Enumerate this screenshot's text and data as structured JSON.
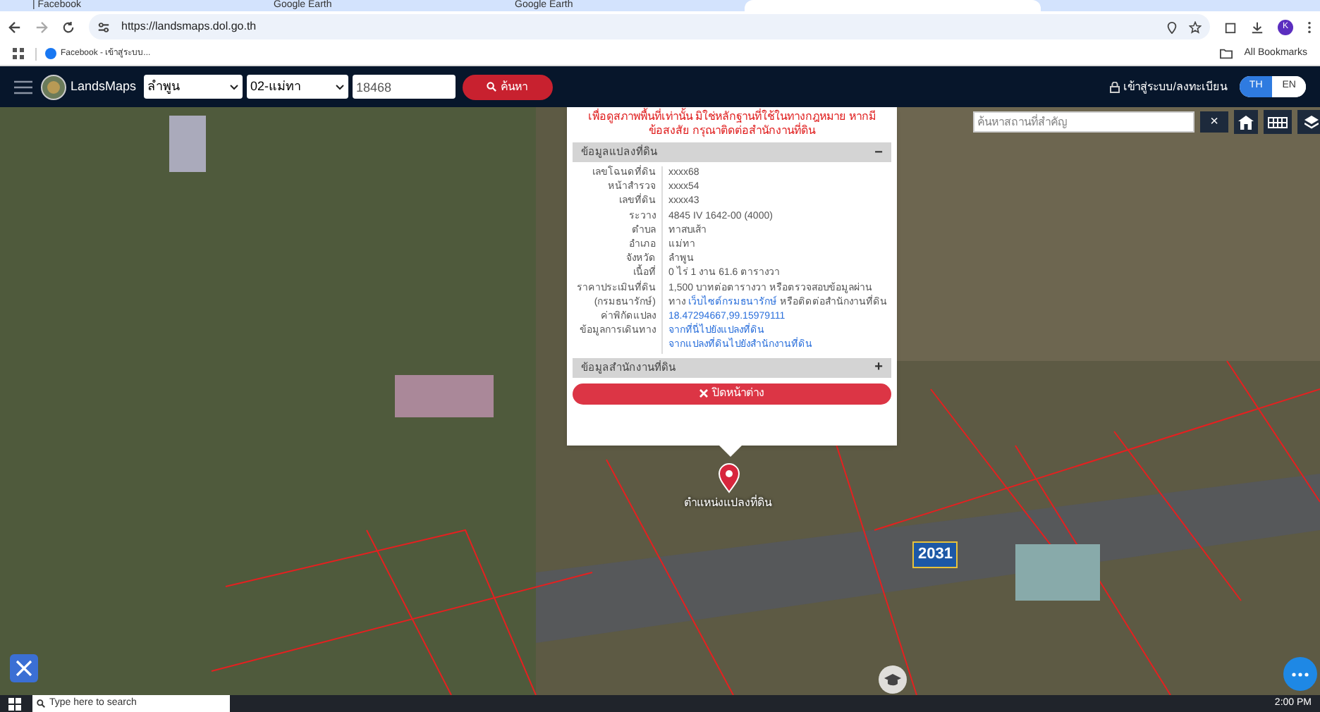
{
  "browser": {
    "tabs": [
      {
        "title": "| Facebook",
        "selected": false
      },
      {
        "title": "Google Earth",
        "selected": false
      },
      {
        "title": "Google Earth",
        "selected": false
      },
      {
        "selected": true
      }
    ],
    "url": "https://landsmaps.dol.go.th",
    "bookmarks": [
      {
        "label": "Facebook - เข้าสู่ระบบ..."
      }
    ],
    "all_bookmarks": "All Bookmarks",
    "profile": "K"
  },
  "app": {
    "brand": "LandsMaps",
    "province": "ลำพูน",
    "district": "02-แม่ทา",
    "parcel_no": "18468",
    "search_button": "ค้นหา",
    "login": "เข้าสู่ระบบ/ลงทะเบียน",
    "languages": [
      {
        "label": "TH",
        "selected": true
      },
      {
        "label": "EN",
        "selected": false
      }
    ]
  },
  "place_search": {
    "placeholder": "ค้นหาสถานที่สำคัญ",
    "clear": "×"
  },
  "popup": {
    "warning": "เพื่อดูสภาพพื้นที่เท่านั้น มิใช่หลักฐานที่ใช้ในทางกฎหมาย หากมีข้อสงสัย กรุณาติดต่อสำนักงานที่ดิน",
    "sections": [
      {
        "title": "ข้อมูลแปลงที่ดิน",
        "expanded": true,
        "sign": "−"
      },
      {
        "title": "ข้อมูลสำนักงานที่ดิน",
        "expanded": false,
        "sign": "+"
      }
    ],
    "rows": [
      {
        "label": "เลขโฉนดที่ดิน",
        "values": [
          {
            "text": "xxxx68",
            "kind": "text"
          }
        ]
      },
      {
        "label": "หน้าสำรวจ",
        "values": [
          {
            "text": "xxxx54",
            "kind": "text"
          }
        ]
      },
      {
        "label": "เลขที่ดิน",
        "values": [
          {
            "text": "xxxx43",
            "kind": "text"
          }
        ]
      },
      {
        "label": "ระวาง",
        "values": [
          {
            "text": "4845 IV 1642-00 (4000)",
            "kind": "text"
          }
        ]
      },
      {
        "label": "ตำบล",
        "values": [
          {
            "text": "ทาสบเส้า",
            "kind": "text"
          }
        ]
      },
      {
        "label": "อำเภอ",
        "values": [
          {
            "text": "แม่ทา",
            "kind": "text"
          }
        ]
      },
      {
        "label": "จังหวัด",
        "values": [
          {
            "text": "ลำพูน",
            "kind": "text"
          }
        ]
      },
      {
        "label": "เนื้อที่",
        "values": [
          {
            "text": "0 ไร่ 1 งาน 61.6 ตารางวา",
            "kind": "text"
          }
        ]
      },
      {
        "label": "ราคาประเมินที่ดิน",
        "values": [
          {
            "text": "1,500 บาทต่อตารางวา หรือตรวจสอบข้อมูลผ่าน",
            "kind": "text"
          }
        ]
      },
      {
        "label": "(กรมธนารักษ์)",
        "values": [
          {
            "text": "ทาง",
            "kind": "text"
          },
          {
            "text": "เว็บไซต์กรมธนารักษ์",
            "kind": "link"
          },
          {
            "text": "หรือติดต่อสำนักงานที่ดิน",
            "kind": "text"
          }
        ]
      },
      {
        "label": "ค่าพิกัดแปลง",
        "values": [
          {
            "text": "18.47294667,99.15979111",
            "kind": "link"
          }
        ]
      },
      {
        "label": "ข้อมูลการเดินทาง",
        "values": [
          {
            "text": "จากที่นี่ไปยังแปลงที่ดิน",
            "kind": "link"
          }
        ]
      },
      {
        "values": [
          {
            "text": "จากแปลงที่ดินไปยังสำนักงานที่ดิน",
            "kind": "link"
          }
        ]
      }
    ],
    "close_button": "ปิดหน้าต่าง"
  },
  "map": {
    "marker_label": "ตำแหน่งแปลงที่ดิน",
    "road_label": "2031"
  },
  "taskbar": {
    "search": "Type here to search",
    "time": "2:00 PM"
  }
}
